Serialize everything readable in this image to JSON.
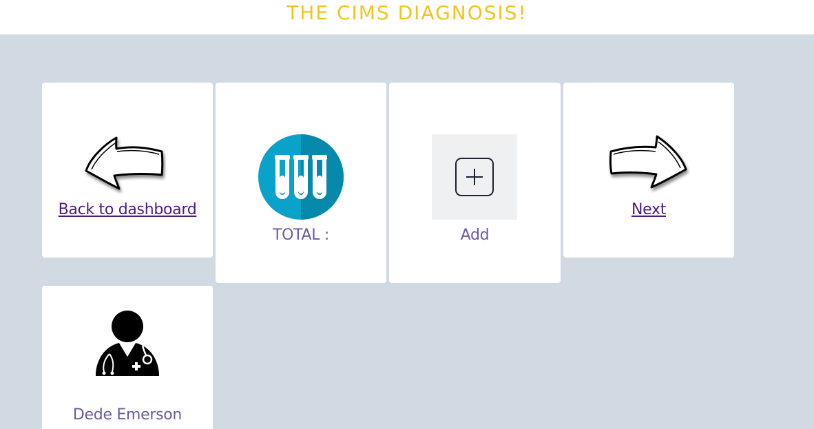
{
  "header": {
    "title": "THE CIMS DIAGNOSIS!"
  },
  "cards": {
    "back": {
      "link_label": "Back to dashboard",
      "icon": "arrow-left-icon"
    },
    "total": {
      "label": "TOTAL :",
      "icon": "test-tubes-icon"
    },
    "add": {
      "label": "Add",
      "icon": "plus-square-icon"
    },
    "next": {
      "link_label": "Next",
      "icon": "arrow-right-icon"
    },
    "doctor": {
      "name": "Dede Emerson",
      "icon": "doctor-icon"
    }
  },
  "colors": {
    "background": "#d1dae2",
    "title": "#f5c31c",
    "link": "#4b1a86",
    "label": "#6c5aa0",
    "tubes_circle": "#0aa2c9"
  }
}
